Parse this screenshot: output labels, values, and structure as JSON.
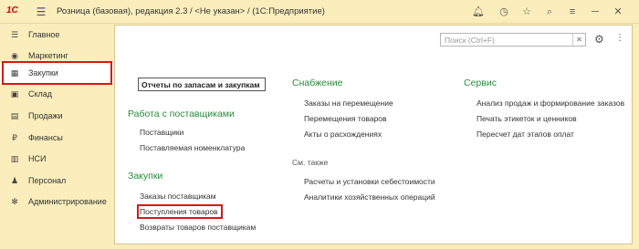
{
  "titlebar": {
    "logo": "1С",
    "title": "Розница (базовая), редакция 2.3 / <Не указан> /  (1С:Предприятие)"
  },
  "sidebar": {
    "items": [
      {
        "label": "Главное",
        "icon": "hamburger-icon"
      },
      {
        "label": "Маркетинг",
        "icon": "marketing-icon"
      },
      {
        "label": "Закупки",
        "icon": "purchases-icon"
      },
      {
        "label": "Склад",
        "icon": "warehouse-icon"
      },
      {
        "label": "Продажи",
        "icon": "sales-icon"
      },
      {
        "label": "Финансы",
        "icon": "finance-icon"
      },
      {
        "label": "НСИ",
        "icon": "reference-icon"
      },
      {
        "label": "Персонал",
        "icon": "personnel-icon"
      },
      {
        "label": "Администрирование",
        "icon": "gear-icon"
      }
    ],
    "active": "Закупки"
  },
  "search": {
    "placeholder": "Поиск (Ctrl+F)"
  },
  "col1": {
    "report_link": "Отчеты по запасам и закупкам",
    "suppliers_title": "Работа с поставщиками",
    "suppliers_links": [
      "Поставщики",
      "Поставляемая номенклатура"
    ],
    "purchases_title": "Закупки",
    "purchases_links": [
      "Заказы поставщикам",
      "Поступления товаров",
      "Возвраты товаров поставщикам"
    ]
  },
  "col2": {
    "title": "Снабжение",
    "links": [
      "Заказы на перемещение",
      "Перемещения товаров",
      "Акты о расхождениях"
    ],
    "see_also": "См. также",
    "see_links": [
      "Расчеты и установки себестоимости",
      "Аналитики хозяйственных операций"
    ]
  },
  "col3": {
    "title": "Сервис",
    "links": [
      "Анализ продаж и формирование заказов",
      "Печать этикеток и ценников",
      "Пересчет дат этапов оплат"
    ]
  }
}
